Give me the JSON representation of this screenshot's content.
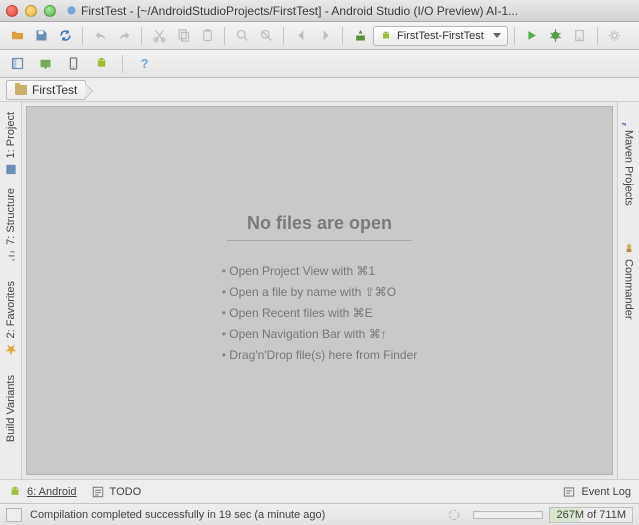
{
  "window": {
    "title": "FirstTest - [~/AndroidStudioProjects/FirstTest] - Android Studio (I/O Preview) AI-1..."
  },
  "toolbar": {
    "run_config_label": "FirstTest-FirstTest"
  },
  "breadcrumb": {
    "root": "FirstTest"
  },
  "left_tabs": {
    "project": "1: Project",
    "structure": "7: Structure",
    "favorites": "2: Favorites",
    "build_variants": "Build Variants"
  },
  "right_tabs": {
    "maven": "Maven Projects",
    "commander": "Commander"
  },
  "editor": {
    "heading": "No files are open",
    "hints": [
      "Open Project View with ⌘1",
      "Open a file by name with ⇧⌘O",
      "Open Recent files with ⌘E",
      "Open Navigation Bar with ⌘↑",
      "Drag'n'Drop file(s) here from Finder"
    ]
  },
  "bottom": {
    "android": "6: Android",
    "todo": "TODO",
    "event_log": "Event Log"
  },
  "status": {
    "message": "Compilation completed successfully in 19 sec (a minute ago)",
    "memory": "267M of 711M"
  }
}
